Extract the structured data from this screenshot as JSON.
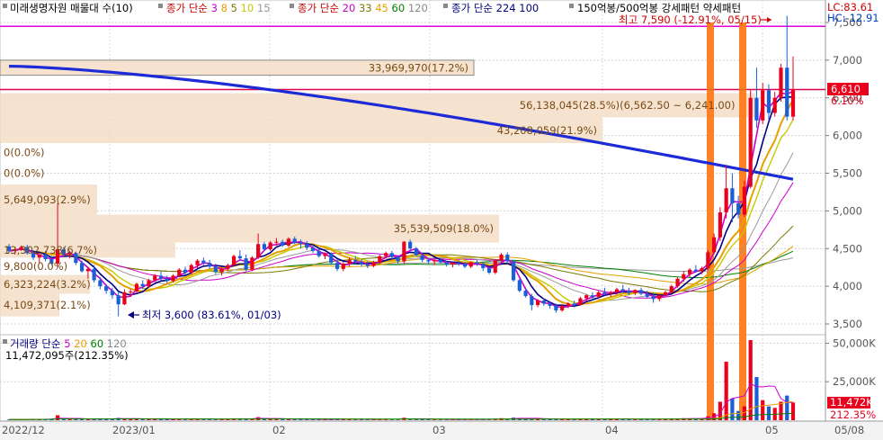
{
  "legend": {
    "price_title": "미래생명자원 매물대 수(10)",
    "ma_groups": [
      {
        "label": "종가 단순",
        "periods": [
          "3",
          "8",
          "5",
          "10",
          "15"
        ],
        "label_color": "#c80000",
        "period_colors": [
          "#cc00cc",
          "#e6a000",
          "#7a7a00",
          "#c8c800",
          "#9a9a9a"
        ]
      },
      {
        "label": "종가 단순",
        "periods": [
          "20",
          "33",
          "45",
          "60",
          "120"
        ],
        "label_color": "#c80000",
        "period_colors": [
          "#cc00cc",
          "#7a7a00",
          "#e6a000",
          "#008000",
          "#888888"
        ]
      },
      {
        "label": "종가 단순",
        "periods": [
          "224",
          "100"
        ],
        "label_color": "#000080",
        "period_colors": [
          "#000080",
          "#000080"
        ]
      }
    ],
    "pattern_label": "150억봉/500억봉 강세패턴 약세패턴"
  },
  "price_scale": {
    "ticks": [
      "7,500",
      "7,000",
      "6,500",
      "6,000",
      "5,500",
      "5,000",
      "4,500",
      "4,000",
      "3,500"
    ],
    "lc": "LC:83.61",
    "hc": "HC:-12.91",
    "current_price": "6,610",
    "current_change": "6.10%"
  },
  "volume_scale": {
    "ticks": [
      "50,000K",
      "25,000K"
    ],
    "current_volume": "11,472K",
    "current_ratio": "212.35%"
  },
  "volume_legend": {
    "label": "거래량 단순",
    "periods": [
      "5",
      "20",
      "60",
      "120"
    ],
    "period_colors": [
      "#cc00cc",
      "#e6a000",
      "#008000",
      "#888888"
    ],
    "value": "11,472,095주(212.35%)"
  },
  "annotations": {
    "high": "최고 7,590 (-12.91%, 05/15)",
    "low": "최저 3,600 (83.61%, 01/03)"
  },
  "volume_profile_labels": [
    "33,969,970(17.2%)",
    "56,138,045(28.5%)(6,562.50 ~ 6,241.00)",
    "43,208,059(21.9%)",
    "0(0.0%)",
    "0(0.0%)",
    "5,649,093(2.9%)",
    "35,539,509(18.0%)",
    "13,302,738(6.7%)",
    "9,800(0.0%)",
    "6,323,224(3.2%)",
    "4,109,371(2.1%)"
  ],
  "x_axis": {
    "labels": [
      "2022/12",
      "2023/01",
      "02",
      "03",
      "04",
      "05",
      "05/08"
    ]
  },
  "chart_data": {
    "type": "candlestick",
    "title": "미래생명자원",
    "x": [
      "2022/12",
      "2023/01",
      "02",
      "03",
      "04",
      "05"
    ],
    "price_range": [
      3500,
      7500
    ],
    "high": {
      "value": 7590,
      "date": "05/15"
    },
    "low": {
      "value": 3600,
      "date": "01/03"
    },
    "last_close": 6610,
    "candles_ohlc": [
      [
        4530,
        4560,
        4440,
        4470
      ],
      [
        4470,
        4520,
        4420,
        4490
      ],
      [
        4490,
        4540,
        4470,
        4520
      ],
      [
        4520,
        4550,
        4420,
        4440
      ],
      [
        4440,
        4480,
        4350,
        4380
      ],
      [
        4380,
        4450,
        4300,
        4420
      ],
      [
        4420,
        4470,
        4330,
        4360
      ],
      [
        4360,
        4400,
        4280,
        4300
      ],
      [
        4300,
        5100,
        4250,
        4490
      ],
      [
        4490,
        4520,
        4400,
        4420
      ],
      [
        4420,
        4470,
        4370,
        4440
      ],
      [
        4440,
        4460,
        4280,
        4310
      ],
      [
        4310,
        4340,
        4180,
        4200
      ],
      [
        4200,
        4260,
        4100,
        4230
      ],
      [
        4230,
        4280,
        4050,
        4080
      ],
      [
        4080,
        4120,
        3960,
        4000
      ],
      [
        4000,
        4030,
        3900,
        3940
      ],
      [
        3940,
        3980,
        3830,
        3880
      ],
      [
        3880,
        3920,
        3600,
        3760
      ],
      [
        3760,
        3960,
        3750,
        3920
      ],
      [
        3920,
        3960,
        3860,
        3930
      ],
      [
        3930,
        4050,
        3900,
        4030
      ],
      [
        4030,
        4080,
        3960,
        4000
      ],
      [
        4000,
        4100,
        3980,
        4080
      ],
      [
        4080,
        4160,
        4060,
        4140
      ],
      [
        4140,
        4200,
        4080,
        4100
      ],
      [
        4100,
        4140,
        4040,
        4070
      ],
      [
        4070,
        4160,
        4050,
        4140
      ],
      [
        4140,
        4240,
        4120,
        4220
      ],
      [
        4220,
        4260,
        4150,
        4180
      ],
      [
        4180,
        4300,
        4160,
        4280
      ],
      [
        4280,
        4360,
        4240,
        4340
      ],
      [
        4340,
        4380,
        4280,
        4310
      ],
      [
        4310,
        4350,
        4230,
        4260
      ],
      [
        4260,
        4300,
        4160,
        4190
      ],
      [
        4190,
        4250,
        4140,
        4230
      ],
      [
        4230,
        4300,
        4200,
        4280
      ],
      [
        4280,
        4420,
        4260,
        4400
      ],
      [
        4400,
        4480,
        4340,
        4370
      ],
      [
        4370,
        4420,
        4200,
        4220
      ],
      [
        4220,
        4400,
        4200,
        4380
      ],
      [
        4380,
        4700,
        4360,
        4560
      ],
      [
        4560,
        4590,
        4470,
        4490
      ],
      [
        4490,
        4600,
        4470,
        4580
      ],
      [
        4580,
        4640,
        4540,
        4590
      ],
      [
        4590,
        4620,
        4520,
        4540
      ],
      [
        4540,
        4650,
        4520,
        4630
      ],
      [
        4630,
        4660,
        4560,
        4580
      ],
      [
        4580,
        4620,
        4500,
        4560
      ],
      [
        4560,
        4600,
        4480,
        4510
      ],
      [
        4510,
        4550,
        4440,
        4470
      ],
      [
        4470,
        4500,
        4380,
        4400
      ],
      [
        4400,
        4450,
        4360,
        4430
      ],
      [
        4430,
        4450,
        4290,
        4310
      ],
      [
        4310,
        4360,
        4200,
        4230
      ],
      [
        4230,
        4320,
        4200,
        4300
      ],
      [
        4300,
        4380,
        4260,
        4350
      ],
      [
        4350,
        4400,
        4290,
        4320
      ],
      [
        4320,
        4360,
        4260,
        4290
      ],
      [
        4290,
        4330,
        4240,
        4270
      ],
      [
        4270,
        4340,
        4250,
        4320
      ],
      [
        4320,
        4420,
        4300,
        4400
      ],
      [
        4400,
        4460,
        4370,
        4440
      ],
      [
        4440,
        4470,
        4360,
        4390
      ],
      [
        4390,
        4400,
        4300,
        4330
      ],
      [
        4330,
        4600,
        4300,
        4590
      ],
      [
        4590,
        4620,
        4480,
        4500
      ],
      [
        4500,
        4520,
        4400,
        4410
      ],
      [
        4410,
        4440,
        4320,
        4350
      ],
      [
        4350,
        4370,
        4300,
        4330
      ],
      [
        4330,
        4360,
        4280,
        4350
      ],
      [
        4350,
        4380,
        4300,
        4320
      ],
      [
        4320,
        4340,
        4260,
        4290
      ],
      [
        4290,
        4320,
        4250,
        4310
      ],
      [
        4310,
        4340,
        4270,
        4300
      ],
      [
        4300,
        4320,
        4240,
        4260
      ],
      [
        4260,
        4330,
        4240,
        4320
      ],
      [
        4320,
        4350,
        4270,
        4300
      ],
      [
        4300,
        4320,
        4200,
        4240
      ],
      [
        4240,
        4260,
        4160,
        4180
      ],
      [
        4180,
        4360,
        4160,
        4340
      ],
      [
        4340,
        4440,
        4320,
        4420
      ],
      [
        4420,
        4450,
        4300,
        4330
      ],
      [
        4330,
        4350,
        4060,
        4080
      ],
      [
        4080,
        4100,
        3920,
        3940
      ],
      [
        3940,
        3980,
        3850,
        3870
      ],
      [
        3870,
        3900,
        3680,
        3750
      ],
      [
        3750,
        3830,
        3720,
        3810
      ],
      [
        3810,
        3840,
        3740,
        3770
      ],
      [
        3770,
        3800,
        3700,
        3740
      ],
      [
        3740,
        3770,
        3650,
        3680
      ],
      [
        3680,
        3760,
        3660,
        3740
      ],
      [
        3740,
        3790,
        3710,
        3770
      ],
      [
        3770,
        3810,
        3720,
        3750
      ],
      [
        3750,
        3860,
        3740,
        3840
      ],
      [
        3840,
        3900,
        3800,
        3880
      ],
      [
        3880,
        3920,
        3820,
        3860
      ],
      [
        3860,
        3940,
        3840,
        3920
      ],
      [
        3920,
        3980,
        3880,
        3900
      ],
      [
        3900,
        3940,
        3860,
        3920
      ],
      [
        3920,
        3980,
        3900,
        3960
      ],
      [
        3960,
        4020,
        3920,
        3940
      ],
      [
        3940,
        3980,
        3880,
        3910
      ],
      [
        3910,
        3960,
        3880,
        3950
      ],
      [
        3950,
        3980,
        3880,
        3900
      ],
      [
        3900,
        3940,
        3840,
        3860
      ],
      [
        3860,
        3920,
        3780,
        3830
      ],
      [
        3830,
        3900,
        3800,
        3880
      ],
      [
        3880,
        3940,
        3860,
        3920
      ],
      [
        3920,
        4020,
        3900,
        4000
      ],
      [
        4000,
        4120,
        3980,
        4100
      ],
      [
        4100,
        4200,
        4060,
        4160
      ],
      [
        4160,
        4240,
        4120,
        4220
      ],
      [
        4220,
        4280,
        4180,
        4200
      ],
      [
        4200,
        4260,
        4160,
        4240
      ],
      [
        4240,
        4480,
        4220,
        4450
      ],
      [
        4450,
        4700,
        4420,
        4650
      ],
      [
        4650,
        5050,
        4600,
        4980
      ],
      [
        4980,
        5600,
        4900,
        5300
      ],
      [
        5300,
        5500,
        4850,
        5100
      ],
      [
        5100,
        5200,
        4900,
        4950
      ],
      [
        4950,
        5400,
        4920,
        5320
      ],
      [
        5320,
        6600,
        5300,
        6500
      ],
      [
        6500,
        6900,
        6100,
        6200
      ],
      [
        6200,
        6700,
        6150,
        6600
      ],
      [
        6600,
        6680,
        6200,
        6300
      ],
      [
        6300,
        6580,
        6250,
        6500
      ],
      [
        6500,
        6950,
        6450,
        6900
      ],
      [
        6900,
        7590,
        6200,
        6250
      ],
      [
        6250,
        7050,
        6200,
        6610
      ]
    ],
    "volume_k": [
      450,
      500,
      480,
      520,
      600,
      700,
      650,
      900,
      3200,
      600,
      550,
      620,
      700,
      650,
      800,
      900,
      1000,
      1100,
      1500,
      900,
      700,
      800,
      650,
      700,
      750,
      600,
      550,
      650,
      700,
      600,
      750,
      800,
      650,
      600,
      650,
      700,
      750,
      1200,
      900,
      800,
      1100,
      2000,
      900,
      800,
      700,
      650,
      750,
      700,
      600,
      550,
      500,
      520,
      550,
      600,
      700,
      650,
      600,
      550,
      500,
      480,
      520,
      700,
      650,
      550,
      500,
      1600,
      900,
      700,
      600,
      550,
      500,
      480,
      450,
      500,
      480,
      460,
      500,
      480,
      520,
      600,
      1000,
      1300,
      800,
      1700,
      1400,
      900,
      1200,
      800,
      700,
      650,
      700,
      600,
      650,
      700,
      800,
      750,
      700,
      800,
      750,
      700,
      650,
      700,
      650,
      600,
      650,
      700,
      750,
      650,
      700,
      900,
      1100,
      1300,
      1200,
      1000,
      1100,
      2500,
      4500,
      12000,
      38000,
      14000,
      6000,
      9000,
      52000,
      28000,
      13000,
      9000,
      8000,
      12000,
      16000,
      11472
    ],
    "volume_profile": [
      {
        "label": "33,969,970(17.2%)",
        "price_from": 6800,
        "price_to": 7000,
        "volume": 33969970,
        "pct": 17.2
      },
      {
        "label": "56,138,045(28.5%)(6,562.50 ~ 6,241.00)",
        "price_from": 6241,
        "price_to": 6562.5,
        "volume": 56138045,
        "pct": 28.5
      },
      {
        "label": "43,208,059(21.9%)",
        "price_from": 5900,
        "price_to": 6240,
        "volume": 43208059,
        "pct": 21.9
      },
      {
        "label": "0(0.0%)",
        "price_from": 5650,
        "price_to": 5900,
        "volume": 0,
        "pct": 0
      },
      {
        "label": "0(0.0%)",
        "price_from": 5350,
        "price_to": 5650,
        "volume": 0,
        "pct": 0
      },
      {
        "label": "5,649,093(2.9%)",
        "price_from": 4950,
        "price_to": 5350,
        "volume": 5649093,
        "pct": 2.9
      },
      {
        "label": "35,539,509(18.0%)",
        "price_from": 4580,
        "price_to": 4950,
        "volume": 35539509,
        "pct": 18.0
      },
      {
        "label": "13,302,738(6.7%)",
        "price_from": 4380,
        "price_to": 4580,
        "volume": 13302738,
        "pct": 6.7
      },
      {
        "label": "9,800(0.0%)",
        "price_from": 4150,
        "price_to": 4380,
        "volume": 9800,
        "pct": 0
      },
      {
        "label": "6,323,224(3.2%)",
        "price_from": 3900,
        "price_to": 4150,
        "volume": 6323224,
        "pct": 3.2
      },
      {
        "label": "4,109,371(2.1%)",
        "price_from": 3600,
        "price_to": 3900,
        "volume": 4109371,
        "pct": 2.1
      }
    ],
    "reference_lines": {
      "high_price": 7450,
      "current_price": 6610
    }
  }
}
